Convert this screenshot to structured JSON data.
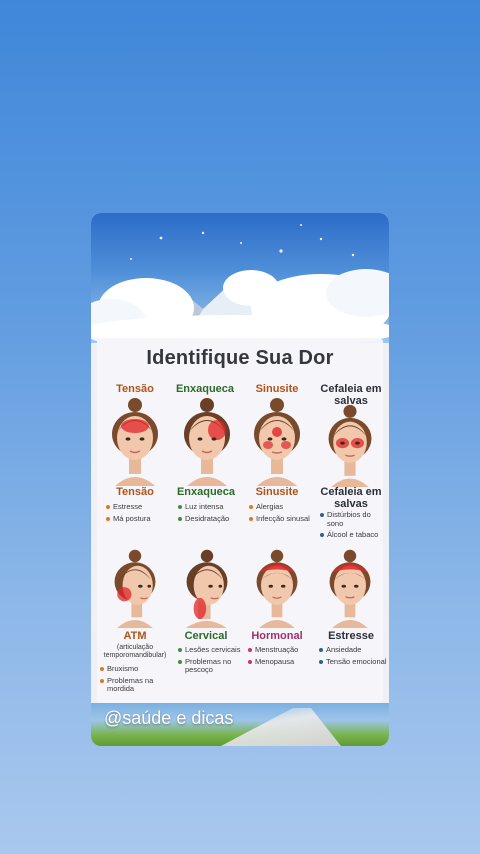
{
  "post": {
    "title": "Identifique Sua Dor",
    "handle": "@saúde e dicas"
  },
  "colors": {
    "tensao": "#b0531a",
    "enxaqueca": "#2b6a2a",
    "sinusite": "#b0531a",
    "cefaleia": "#2b2f3a",
    "atm": "#b0531a",
    "cervical": "#2b6a2a",
    "hormonal": "#a0306a",
    "estresse": "#2b2f3a",
    "pain_red": "#e0262a"
  },
  "top_row": [
    {
      "key": "tensao",
      "header": "Tensão",
      "name": "Tensão",
      "bullets": [
        "Estresse",
        "Má postura"
      ],
      "dot": "#e07a1e"
    },
    {
      "key": "enxaqueca",
      "header": "Enxaqueca",
      "name": "Enxaqueca",
      "bullets": [
        "Luz intensa",
        "Desidratação"
      ],
      "dot": "#3f8f3a"
    },
    {
      "key": "sinusite",
      "header": "Sinusite",
      "name": "Sinusite",
      "bullets": [
        "Alergias",
        "Infecção sinusal"
      ],
      "dot": "#e07a1e"
    },
    {
      "key": "cefaleia",
      "header": "Cefaleia em salvas",
      "name": "Cefaleia em salvas",
      "bullets": [
        "Distúrbios do sono",
        "Álcool e tabaco"
      ],
      "dot": "#2e5f9a"
    }
  ],
  "bottom_row": [
    {
      "key": "atm",
      "name": "ATM",
      "subtitle": "(articulação temporomandibular)",
      "bullets": [
        "Bruxismo",
        "Problemas na mordida"
      ],
      "dot": "#e07a1e"
    },
    {
      "key": "cervical",
      "name": "Cervical",
      "bullets": [
        "Lesões cervicais",
        "Problemas no pescoço"
      ],
      "dot": "#3f8f3a"
    },
    {
      "key": "hormonal",
      "name": "Hormonal",
      "bullets": [
        "Menstruação",
        "Menopausa"
      ],
      "dot": "#c2347a"
    },
    {
      "key": "estresse",
      "name": "Estresse",
      "bullets": [
        "Ansiedade",
        "Tensão emocional"
      ],
      "dot": "#2e5f9a"
    }
  ]
}
